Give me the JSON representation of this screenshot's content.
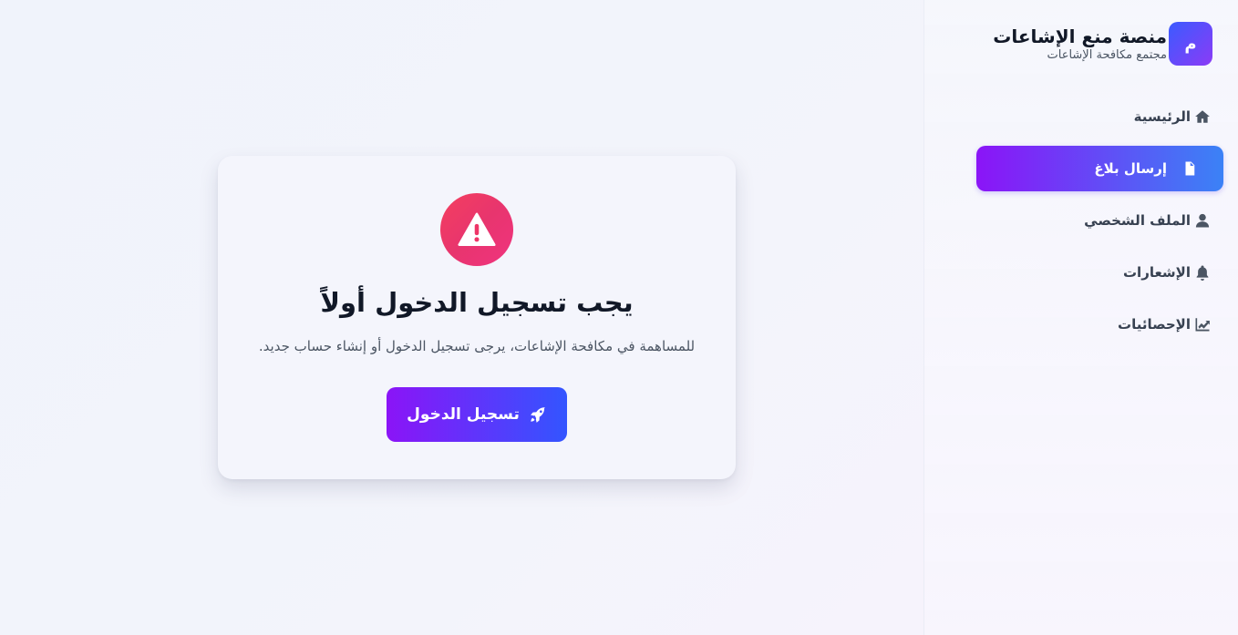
{
  "brand": {
    "logo_letter": "م",
    "title": "منصة منع الإشاعات",
    "subtitle": "مجتمع مكافحة الإشاعات"
  },
  "nav": {
    "items": [
      {
        "label": "الرئيسية",
        "icon": "home-icon",
        "active": false
      },
      {
        "label": "إرسال بلاغ",
        "icon": "document-icon",
        "active": true
      },
      {
        "label": "الملف الشخصي",
        "icon": "user-icon",
        "active": false
      },
      {
        "label": "الإشعارات",
        "icon": "bell-icon",
        "active": false
      },
      {
        "label": "الإحصائيات",
        "icon": "chart-icon",
        "active": false
      }
    ]
  },
  "card": {
    "icon": "warning-icon",
    "title": "يجب تسجيل الدخول أولاً",
    "description": "للمساهمة في مكافحة الإشاعات، يرجى تسجيل الدخول أو إنشاء حساب جديد.",
    "button_label": "تسجيل الدخول",
    "button_icon": "rocket-icon"
  },
  "colors": {
    "accent_start": "#3355ff",
    "accent_end": "#8b14f7",
    "warning": "#f43f5e"
  }
}
